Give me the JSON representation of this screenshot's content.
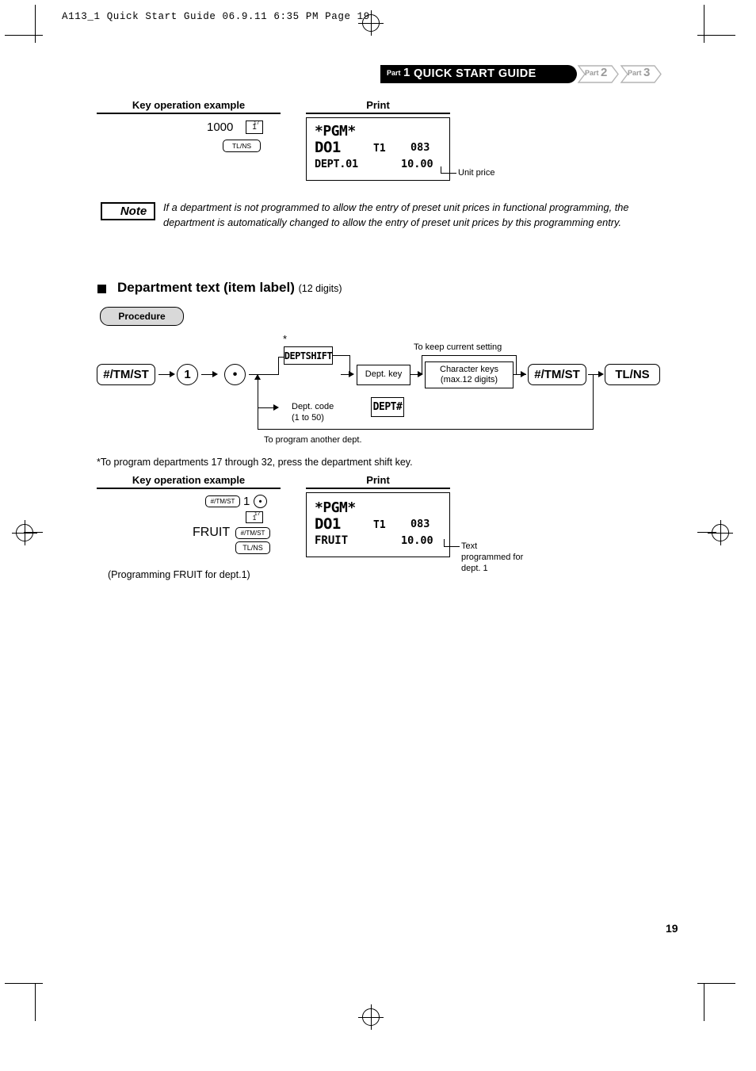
{
  "slug": "A113_1 Quick Start Guide   06.9.11 6:35 PM   Page 19",
  "banner": {
    "part_word": "Part",
    "part_num": "1",
    "title": "QUICK START GUIDE",
    "tab2_word": "Part",
    "tab2_num": "2",
    "tab3_word": "Part",
    "tab3_num": "3"
  },
  "section1": {
    "col_left": "Key operation example",
    "col_right": "Print",
    "entry_value": "1000",
    "key_dept": "1",
    "key_dept_sup": "17",
    "key_tlns": "TL/NS",
    "receipt": {
      "pgm": "*PGM*",
      "do": "DO1",
      "t1": "T1",
      "code": "083",
      "dept": "DEPT.01",
      "amount": "10.00"
    },
    "callout": "Unit price"
  },
  "note": {
    "label": "Note",
    "text": "If a department is not programmed to allow the entry of preset unit prices in functional programming, the department is automatically changed to allow the entry of preset unit prices by this programming entry."
  },
  "section2": {
    "heading": "Department text (item label)",
    "heading_sub": "(12 digits)",
    "procedure": "Procedure",
    "flow": {
      "key_tmst": "#/TM/ST",
      "key_one": "1",
      "key_dot": "•",
      "key_deptshift": "DEPTSHIFT",
      "asterisk": "*",
      "box_deptkey": "Dept. key",
      "label_deptcode": "Dept. code",
      "label_deptcode_range": "(1 to 50)",
      "key_dept_hash": "DEPT#",
      "label_keep": "To keep current setting",
      "box_charkeys_line1": "Character keys",
      "box_charkeys_line2": "(max.12 digits)",
      "key_tmst2": "#/TM/ST",
      "key_tlns": "TL/NS",
      "label_another": "To program another dept."
    },
    "footnote": "*To program departments 17 through 32, press the department shift key.",
    "col_left": "Key operation example",
    "col_right": "Print",
    "example": {
      "key_tmst": "#/TM/ST",
      "digit": "1",
      "dot": "•",
      "sub_digit": "1",
      "sub_sup": "17",
      "text_value": "FRUIT",
      "key_tmst2": "#/TM/ST",
      "key_tlns": "TL/NS"
    },
    "receipt": {
      "pgm": "*PGM*",
      "do": "DO1",
      "t1": "T1",
      "code": "083",
      "text": "FRUIT",
      "amount": "10.00"
    },
    "callout_line1": "Text",
    "callout_line2": "programmed for",
    "callout_line3": "dept. 1",
    "caption": "(Programming FRUIT for dept.1)"
  },
  "page_number": "19"
}
